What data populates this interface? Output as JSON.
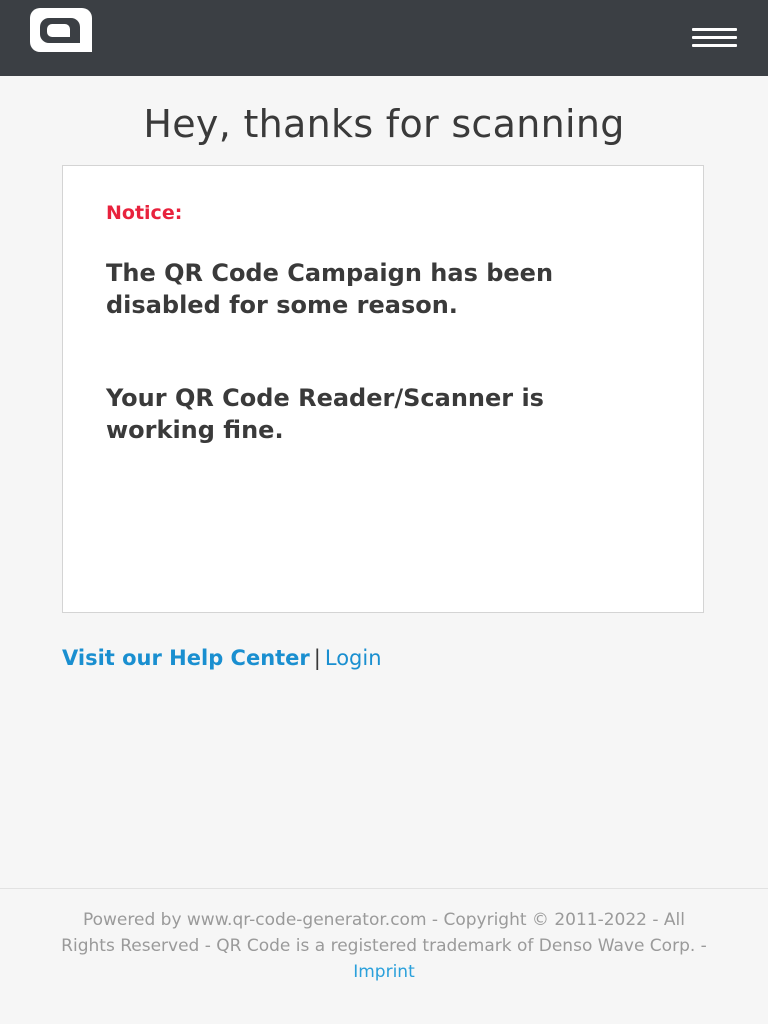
{
  "header": {
    "logo_icon": "brand-logo-icon",
    "menu_icon": "hamburger-menu-icon",
    "background_color": "#3b3f44"
  },
  "main": {
    "title": "Hey, thanks for scanning",
    "notice": {
      "label": "Notice:",
      "label_color": "#e8223d",
      "message_1": "The QR Code Campaign has been disabled for some reason.",
      "message_2": "Your QR Code Reader/Scanner is working fine."
    },
    "links": {
      "help_center": "Visit our Help Center",
      "separator": "|",
      "login": "Login",
      "link_color": "#1a8fd0"
    }
  },
  "footer": {
    "text": "Powered by www.qr-code-generator.com - Copyright © 2011-2022 - All Rights Reserved - QR Code is a registered trademark of Denso Wave Corp. - ",
    "imprint": "Imprint"
  }
}
